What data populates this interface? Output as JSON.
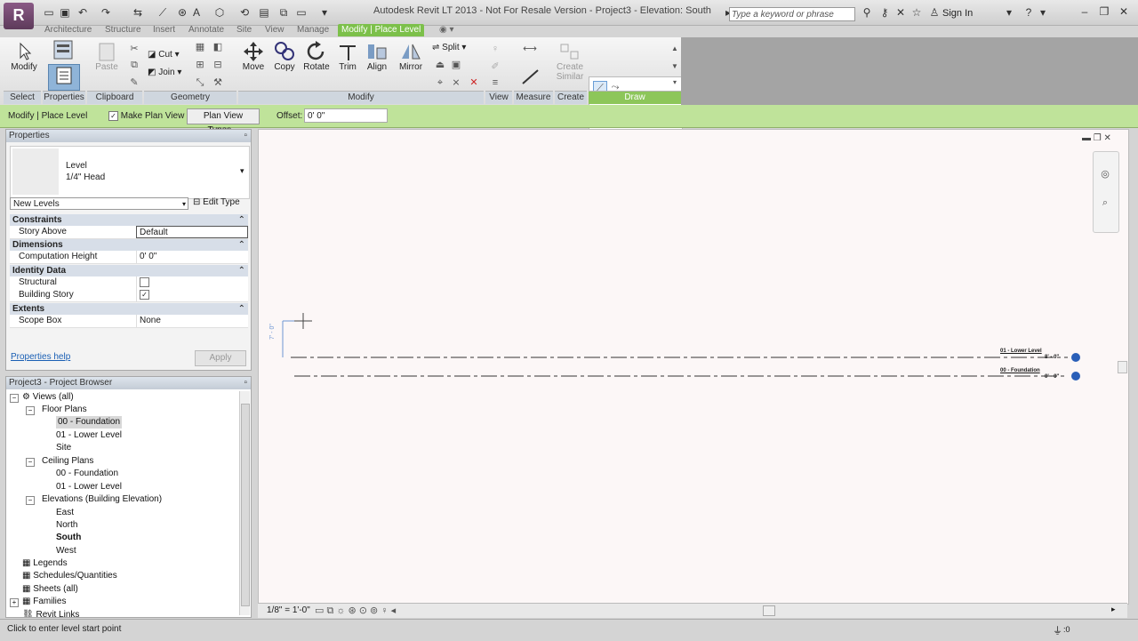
{
  "app": {
    "logo_letter": "R"
  },
  "titlebar": {
    "title": "Autodesk Revit LT 2013 -  Not For Resale Version -     Project3 - Elevation: South",
    "search_placeholder": "Type a keyword or phrase",
    "signin": "Sign In"
  },
  "tabs": [
    "Architecture",
    "Structure",
    "Insert",
    "Annotate",
    "Site",
    "View",
    "Manage",
    "Modify | Place Level"
  ],
  "ribbon": {
    "modify": "Modify",
    "properties": "Properties",
    "paste": "Paste",
    "cut": "Cut",
    "join": "Join",
    "move": "Move",
    "copy": "Copy",
    "rotate": "Rotate",
    "trim": "Trim",
    "align": "Align",
    "mirror": "Mirror",
    "split": "Split",
    "create_similar": "Create Similar",
    "panels": [
      "Select",
      "Properties",
      "Clipboard",
      "Geometry",
      "Modify",
      "View",
      "Measure",
      "Create",
      "Draw"
    ]
  },
  "optionsbar": {
    "context": "Modify | Place Level",
    "make_plan_view": "Make Plan View",
    "plan_view_types": "Plan View Types...",
    "offset_label": "Offset:",
    "offset_value": "0'  0\""
  },
  "properties": {
    "header": "Properties",
    "type_family": "Level",
    "type_name": "1/4\" Head",
    "instance_selector": "New Levels",
    "edit_type": "Edit Type",
    "groups": [
      {
        "name": "Constraints",
        "rows": [
          {
            "key": "Story Above",
            "value": "Default"
          }
        ]
      },
      {
        "name": "Dimensions",
        "rows": [
          {
            "key": "Computation Height",
            "value": "0'  0\""
          }
        ]
      },
      {
        "name": "Identity Data",
        "rows": [
          {
            "key": "Structural",
            "value": ""
          },
          {
            "key": "Building Story",
            "value": ""
          }
        ]
      },
      {
        "name": "Extents",
        "rows": [
          {
            "key": "Scope Box",
            "value": "None"
          }
        ]
      }
    ],
    "help": "Properties help",
    "apply": "Apply"
  },
  "browser": {
    "header": "Project3 - Project Browser",
    "items": [
      {
        "label": "Views (all)"
      },
      {
        "label": "Floor Plans"
      },
      {
        "label": "00 - Foundation"
      },
      {
        "label": "01 - Lower Level"
      },
      {
        "label": "Site"
      },
      {
        "label": "Ceiling Plans"
      },
      {
        "label": "00 - Foundation"
      },
      {
        "label": "01 - Lower Level"
      },
      {
        "label": "Elevations (Building Elevation)"
      },
      {
        "label": "East"
      },
      {
        "label": "North"
      },
      {
        "label": "South"
      },
      {
        "label": "West"
      },
      {
        "label": "Legends"
      },
      {
        "label": "Schedules/Quantities"
      },
      {
        "label": "Sheets (all)"
      },
      {
        "label": "Families"
      },
      {
        "label": "Revit Links"
      }
    ]
  },
  "canvas": {
    "levels": [
      {
        "name": "01 - Lower Level",
        "elev": "8' - 0\""
      },
      {
        "name": "00 - Foundation",
        "elev": "0' - 0\""
      }
    ],
    "temp_dim": "7' - 0\""
  },
  "viewctrl": {
    "scale": "1/8\" = 1'-0\""
  },
  "status": {
    "text": "Click to enter level start point",
    "filter_count": ":0"
  }
}
